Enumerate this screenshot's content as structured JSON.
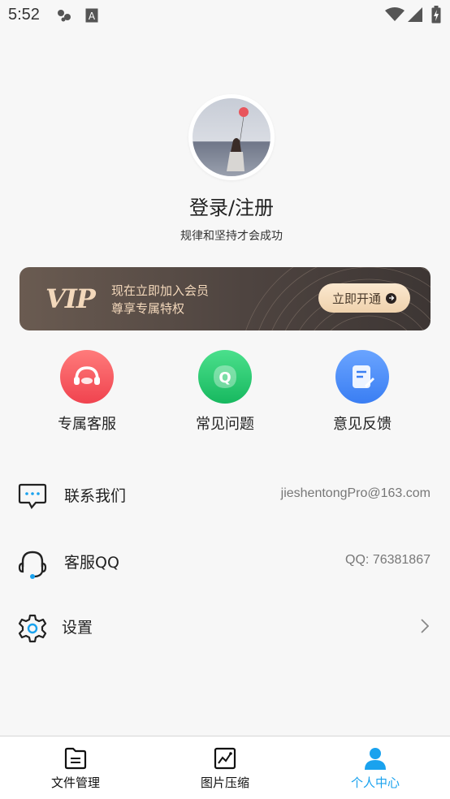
{
  "status_bar": {
    "time": "5:52"
  },
  "profile": {
    "title": "登录/注册",
    "subtitle": "规律和坚持才会成功"
  },
  "vip": {
    "logo": "VIP",
    "line1": "现在立即加入会员",
    "line2": "尊享专属特权",
    "button": "立即开通"
  },
  "features": [
    {
      "label": "专属客服",
      "icon": "headset-icon",
      "color": "#f4515b"
    },
    {
      "label": "常见问题",
      "icon": "faq-icon",
      "color": "#1fc46b"
    },
    {
      "label": "意见反馈",
      "icon": "feedback-icon",
      "color": "#3f86f5"
    }
  ],
  "list": {
    "contact": {
      "label": "联系我们",
      "value": "jieshentongPro@163.com"
    },
    "qq": {
      "label": "客服QQ",
      "value": "QQ: 76381867"
    },
    "settings": {
      "label": "设置"
    }
  },
  "tabs": [
    {
      "label": "文件管理",
      "icon": "file-icon"
    },
    {
      "label": "图片压缩",
      "icon": "image-chart-icon"
    },
    {
      "label": "个人中心",
      "icon": "person-icon",
      "active": true
    }
  ],
  "colors": {
    "accent": "#1aa2ee",
    "vip_gold": "#f3d8bb"
  }
}
